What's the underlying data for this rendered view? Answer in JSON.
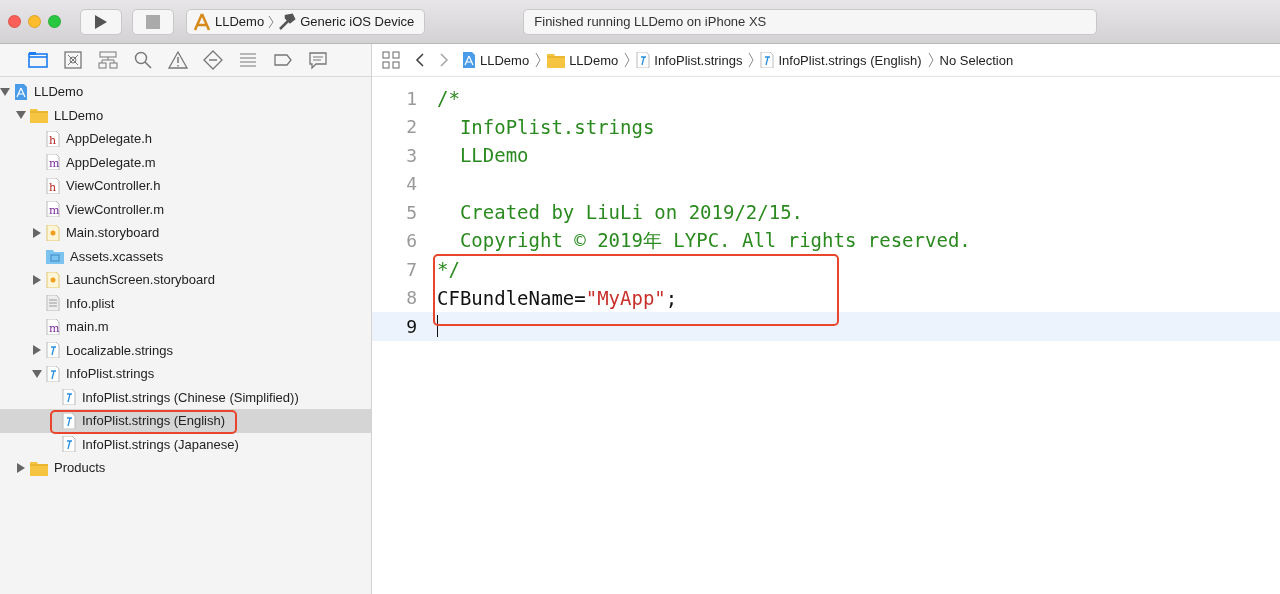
{
  "toolbar": {
    "scheme": "LLDemo",
    "destination": "Generic iOS Device",
    "status": "Finished running LLDemo on iPhone XS"
  },
  "navigator_tabs": [
    {
      "kind": "folder",
      "selected": true
    },
    {
      "kind": "xbox",
      "selected": false
    },
    {
      "kind": "hierarchy",
      "selected": false
    },
    {
      "kind": "search",
      "selected": false
    },
    {
      "kind": "warning",
      "selected": false
    },
    {
      "kind": "diamond",
      "selected": false
    },
    {
      "kind": "list",
      "selected": false
    },
    {
      "kind": "tag",
      "selected": false
    },
    {
      "kind": "comment",
      "selected": false
    }
  ],
  "tree": [
    {
      "label": "LLDemo",
      "kind": "project",
      "expanded": true,
      "selected": false,
      "children": [
        {
          "label": "LLDemo",
          "kind": "folder",
          "expanded": true,
          "selected": false,
          "children": [
            {
              "label": "AppDelegate.h",
              "kind": "h",
              "selected": false
            },
            {
              "label": "AppDelegate.m",
              "kind": "m",
              "selected": false
            },
            {
              "label": "ViewController.h",
              "kind": "h",
              "selected": false
            },
            {
              "label": "ViewController.m",
              "kind": "m",
              "selected": false
            },
            {
              "label": "Main.storyboard",
              "kind": "storyboard",
              "expanded": false,
              "selected": false
            },
            {
              "label": "Assets.xcassets",
              "kind": "assets",
              "selected": false
            },
            {
              "label": "LaunchScreen.storyboard",
              "kind": "storyboard",
              "expanded": false,
              "selected": false
            },
            {
              "label": "Info.plist",
              "kind": "plist",
              "selected": false
            },
            {
              "label": "main.m",
              "kind": "m",
              "selected": false
            },
            {
              "label": "Localizable.strings",
              "kind": "strings",
              "expanded": false,
              "selected": false
            },
            {
              "label": "InfoPlist.strings",
              "kind": "strings",
              "expanded": true,
              "selected": false,
              "children": [
                {
                  "label": "InfoPlist.strings (Chinese (Simplified))",
                  "kind": "strings",
                  "selected": false
                },
                {
                  "label": "InfoPlist.strings (English)",
                  "kind": "strings",
                  "selected": true,
                  "highlighted": true
                },
                {
                  "label": "InfoPlist.strings (Japanese)",
                  "kind": "strings",
                  "selected": false
                }
              ]
            }
          ]
        },
        {
          "label": "Products",
          "kind": "folder",
          "expanded": false,
          "selected": false
        }
      ]
    }
  ],
  "jump_bar": [
    {
      "label": "LLDemo",
      "kind": "project"
    },
    {
      "label": "LLDemo",
      "kind": "folder"
    },
    {
      "label": "InfoPlist.strings",
      "kind": "strings"
    },
    {
      "label": "InfoPlist.strings (English)",
      "kind": "strings"
    },
    {
      "label": "No Selection",
      "kind": "none"
    }
  ],
  "code_lines": [
    {
      "number": "1",
      "segments": [
        {
          "kind": "comment",
          "text": "/*"
        }
      ]
    },
    {
      "number": "2",
      "segments": [
        {
          "kind": "comment",
          "text": "  InfoPlist.strings"
        }
      ]
    },
    {
      "number": "3",
      "segments": [
        {
          "kind": "comment",
          "text": "  LLDemo"
        }
      ]
    },
    {
      "number": "4"
    },
    {
      "number": "5",
      "segments": [
        {
          "kind": "comment",
          "text": "  Created by LiuLi on 2019/2/15."
        }
      ]
    },
    {
      "number": "6",
      "segments": [
        {
          "kind": "comment",
          "text": "  Copyright © 2019年 LYPC. All rights reserved."
        }
      ]
    },
    {
      "number": "7",
      "annotated": true,
      "segments": [
        {
          "kind": "comment",
          "text": "*/"
        }
      ]
    },
    {
      "number": "8",
      "annotated": true,
      "segments": [
        {
          "kind": "plain",
          "text": "CFBundleName="
        },
        {
          "kind": "string",
          "text": "\"MyApp\""
        },
        {
          "kind": "plain",
          "text": ";"
        }
      ]
    },
    {
      "number": "9",
      "annotated": true,
      "current": true
    }
  ]
}
